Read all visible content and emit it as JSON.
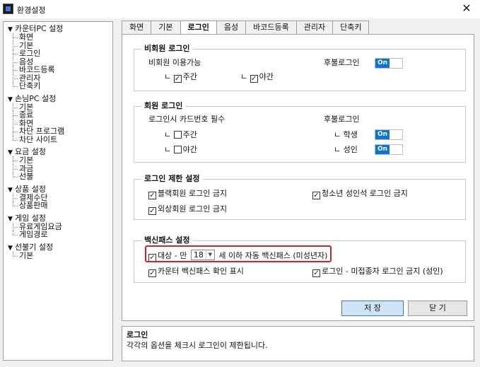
{
  "window": {
    "title": "환경설정",
    "close": "✕"
  },
  "tree": [
    {
      "label": "카운터PC 설정",
      "children": [
        "화면",
        "기본",
        "로그인",
        "음성",
        "바코드등록",
        "관리자",
        "단축키"
      ]
    },
    {
      "label": "손님PC 설정",
      "children": [
        "기본",
        "종료",
        "화면",
        "차단 프로그램",
        "차단 사이트"
      ]
    },
    {
      "label": "요금 설정",
      "children": [
        "기본",
        "과금",
        "선불"
      ]
    },
    {
      "label": "상품 설정",
      "children": [
        "결제수단",
        "상품판매"
      ]
    },
    {
      "label": "게임 설정",
      "children": [
        "유료게임요금",
        "게임경로"
      ]
    },
    {
      "label": "선불기 설정",
      "children": [
        "기본"
      ]
    }
  ],
  "tabs": [
    "화면",
    "기본",
    "로그인",
    "음성",
    "바코드등록",
    "관리자",
    "단축키"
  ],
  "active_tab": "로그인",
  "nonmember": {
    "title": "비회원 로그인",
    "available_label": "비회원 이용가능",
    "day": "주간",
    "night": "야간",
    "postpaid_label": "후불로그인",
    "postpaid_toggle": "On"
  },
  "member": {
    "title": "회원 로그인",
    "card_required_label": "로그인시 카드번호 필수",
    "day": "주간",
    "night": "야간",
    "postpaid_label": "후불로그인",
    "student": "학생",
    "adult": "성인",
    "student_toggle": "On",
    "adult_toggle": "On"
  },
  "restriction": {
    "title": "로그인 제한 설정",
    "blacklist": "블랙회원 로그인 금지",
    "youth_adult_seat": "청소년 성인석 로그인 금지",
    "external": "외상회원 로그인 금지"
  },
  "vaccine": {
    "title": "백신패스 설정",
    "target_prefix": "대상 - 만",
    "age_value": "18",
    "target_suffix": "세 이하 자동 백신패스 (미성년자)",
    "counter_display": "카운터 벡신패스 확인 표시",
    "unvaccinated_block": "로그인 - 미접종자 로그인 금지 (성인)"
  },
  "buttons": {
    "save": "저   장",
    "close": "닫   기"
  },
  "description": {
    "title": "로그인",
    "text": "각각의 옵션을 체크시 로그인이 제한됩니다."
  },
  "colors": {
    "toggle_on": "#0c74d4",
    "highlight": "#d92026",
    "save_button": "#cfe3f6"
  },
  "icons": {
    "check": "☑",
    "tree_expanded": "▼"
  }
}
